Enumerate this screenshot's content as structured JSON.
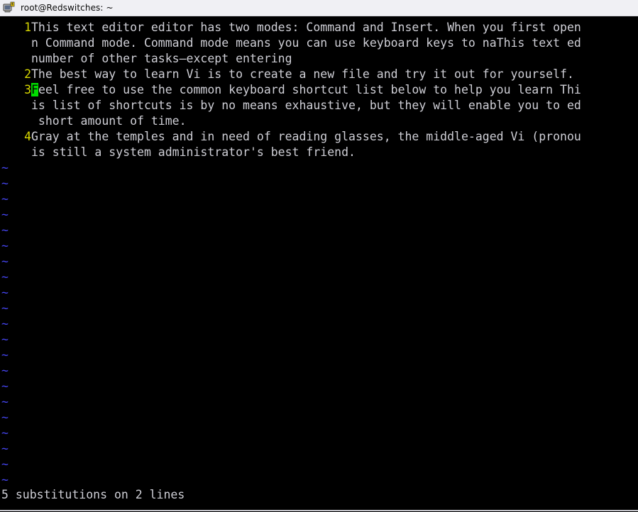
{
  "window": {
    "title": "root@Redswitches: ~",
    "icon": "putty-terminal-icon",
    "titlebar_bg": "#f0f0f4",
    "terminal_bg": "#000000"
  },
  "colors": {
    "foreground": "#cfcfd6",
    "line_number": "#d7d700",
    "tilde": "#4444ee",
    "cursor_bg": "#00dd00",
    "cursor_fg": "#000000"
  },
  "editor": {
    "name": "vi",
    "lines": [
      {
        "number": "1",
        "segments": [
          {
            "text": "This text editor editor has two modes: Command and Insert. When you first open"
          }
        ]
      },
      {
        "number": "",
        "segments": [
          {
            "text": "n Command mode. Command mode means you can use keyboard keys to naThis text ed"
          }
        ]
      },
      {
        "number": "",
        "segments": [
          {
            "text": "number of other tasks—except entering"
          }
        ]
      },
      {
        "number": "2",
        "segments": [
          {
            "text": "The best way to learn Vi is to create a new file and try it out for yourself. "
          }
        ]
      },
      {
        "number": "3",
        "segments": [
          {
            "text": "F",
            "cursor": true
          },
          {
            "text": "eel free to use the common keyboard shortcut list below to help you learn Thi"
          }
        ]
      },
      {
        "number": "",
        "segments": [
          {
            "text": "is list of shortcuts is by no means exhaustive, but they will enable you to ed"
          }
        ]
      },
      {
        "number": "",
        "segments": [
          {
            "text": " short amount of time."
          }
        ]
      },
      {
        "number": "4",
        "segments": [
          {
            "text": "Gray at the temples and in need of reading glasses, the middle-aged Vi (pronou"
          }
        ]
      },
      {
        "number": "",
        "segments": [
          {
            "text": "is still a system administrator's best friend."
          }
        ]
      }
    ],
    "empty_marker": "~",
    "empty_marker_count": 21,
    "status_message": "5 substitutions on 2 lines"
  }
}
